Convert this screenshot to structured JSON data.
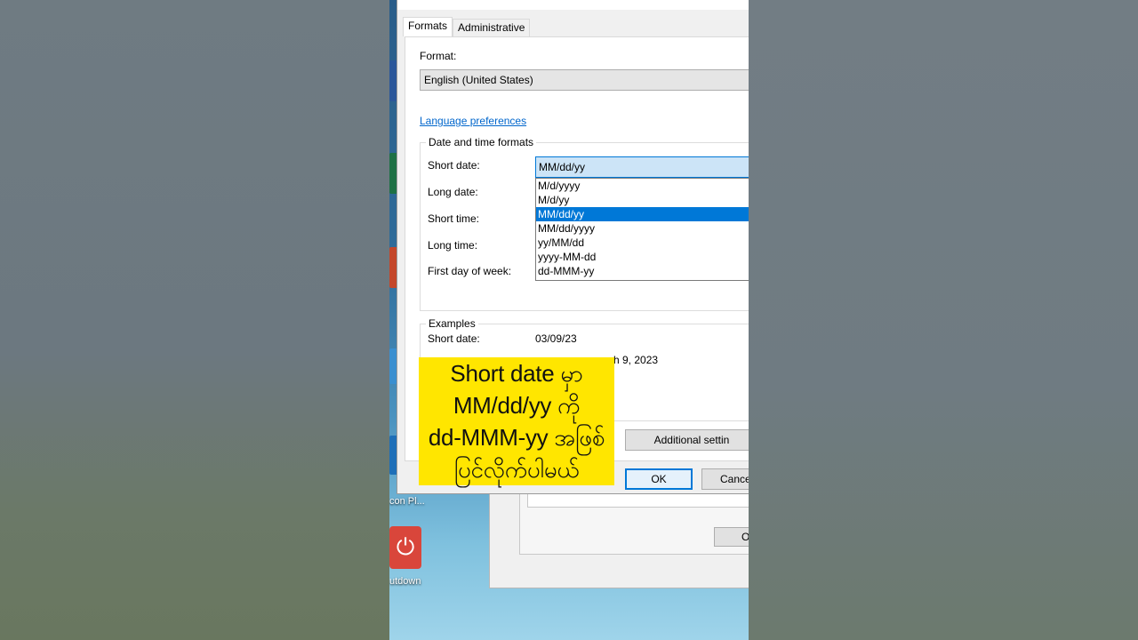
{
  "window": {
    "tabs": [
      "Formats",
      "Administrative"
    ],
    "active_tab": "Formats"
  },
  "formats": {
    "format_label": "Format:",
    "format_value": "English (United States)",
    "language_link": "Language preferences"
  },
  "date_time_group": {
    "title": "Date and time formats",
    "short_date_label": "Short date:",
    "long_date_label": "Long date:",
    "short_time_label": "Short time:",
    "long_time_label": "Long time:",
    "first_day_label": "First day of week:",
    "short_date_value": "MM/dd/yy",
    "dropdown_options": [
      "M/d/yyyy",
      "M/d/yy",
      "MM/dd/yy",
      "MM/dd/yyyy",
      "yy/MM/dd",
      "yyyy-MM-dd",
      "dd-MMM-yy"
    ],
    "selected_index": 2
  },
  "examples_group": {
    "title": "Examples",
    "short_date_label": "Short date:",
    "short_date_value": "03/09/23",
    "long_date_partial": "h 9, 2023"
  },
  "buttons": {
    "additional": "Additional settin",
    "ok": "OK",
    "cancel": "Cance",
    "bg_ok": "O"
  },
  "desktop": {
    "label_1": "con Pl...",
    "label_2": "utdown"
  },
  "caption": {
    "line1": "Short date မှာ",
    "line2": "MM/dd/yy ကို",
    "line3": "dd-MMM-yy အဖြစ်",
    "line4": "ပြင်လိုက်ပါမယ်"
  },
  "colors": {
    "caption_bg": "#ffe600",
    "selection": "#0078d7",
    "link": "#0066cc"
  }
}
